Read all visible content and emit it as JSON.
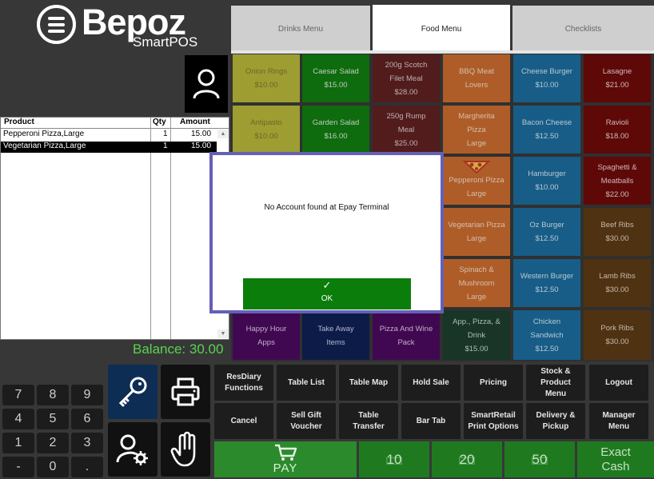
{
  "brand": {
    "name": "Bepoz",
    "sub": "SmartPOS"
  },
  "tabs": [
    {
      "label": "Drinks Menu",
      "active": false
    },
    {
      "label": "Food Menu",
      "active": true
    },
    {
      "label": "Checklists",
      "active": false
    }
  ],
  "order": {
    "headers": {
      "product": "Product",
      "qty": "Qty",
      "amount": "Amount"
    },
    "rows": [
      {
        "product": "Pepperoni Pizza,Large",
        "qty": "1",
        "amount": "15.00",
        "selected": false
      },
      {
        "product": "Vegetarian Pizza,Large",
        "qty": "1",
        "amount": "15.00",
        "selected": true
      }
    ],
    "balance": "Balance: 30.00"
  },
  "menu": {
    "onion_rings": [
      "Onion Rings",
      "$10.00"
    ],
    "caesar_salad": [
      "Caesar Salad",
      "$15.00"
    ],
    "scotch_fillet": [
      "200g Scotch",
      "Filet Meal",
      "$28.00"
    ],
    "bbq_meat": [
      "BBQ Meat",
      "Lovers"
    ],
    "cheese_burger": [
      "Cheese Burger",
      "$10.00"
    ],
    "lasagne": [
      "Lasagne",
      "$21.00"
    ],
    "antipasto": [
      "Antipasto",
      "$10.00"
    ],
    "garden_salad": [
      "Garden Salad",
      "$16.00"
    ],
    "rump_meal": [
      "250g Rump",
      "Meal",
      "$25.00"
    ],
    "margherita": [
      "Margherita",
      "Pizza",
      "Large"
    ],
    "bacon_cheese": [
      "Bacon Cheese",
      "$12.50"
    ],
    "ravioli": [
      "Ravioli",
      "$18.00"
    ],
    "pepperoni": [
      "Pepperoni Pizza",
      "Large"
    ],
    "hamburger": [
      "Hamburger",
      "$10.00"
    ],
    "spaghetti": [
      "Spaghetti &",
      "Meatballs",
      "$22.00"
    ],
    "vegetarian": [
      "Vegetarian Pizza",
      "Large"
    ],
    "oz_burger": [
      "Oz Burger",
      "$12.50"
    ],
    "beef_ribs": [
      "Beef Ribs",
      "$30.00"
    ],
    "spinach": [
      "Spinach &",
      "Mushroom",
      "Large"
    ],
    "western_burger": [
      "Western Burger",
      "$12.50"
    ],
    "lamb_ribs": [
      "Lamb Ribs",
      "$30.00"
    ],
    "happy_hour": [
      "Happy Hour",
      "Apps"
    ],
    "take_away": [
      "Take Away",
      "Items"
    ],
    "pizza_wine": [
      "Pizza And Wine",
      "Pack"
    ],
    "app_pizza": [
      "App., Pizza, &",
      "Drink",
      "$15.00"
    ],
    "chicken_sandwich": [
      "Chicken",
      "Sandwich",
      "$12.50"
    ],
    "pork_ribs": [
      "Pork Ribs",
      "$30.00"
    ]
  },
  "dialog": {
    "message": "No Account found at Epay Terminal",
    "ok_label": "OK",
    "check": "✓"
  },
  "keypad": {
    "k7": "7",
    "k8": "8",
    "k9": "9",
    "k4": "4",
    "k5": "5",
    "k6": "6",
    "k1": "1",
    "k2": "2",
    "k3": "3",
    "kminus": "-",
    "k0": "0",
    "kdot": "."
  },
  "functions": {
    "resdiary": [
      "ResDiary",
      "Functions"
    ],
    "table_list": [
      "Table List"
    ],
    "table_map": [
      "Table Map"
    ],
    "hold_sale": [
      "Hold Sale"
    ],
    "pricing": [
      "Pricing"
    ],
    "stock_menu": [
      "Stock &",
      "Product",
      "Menu"
    ],
    "logout": [
      "Logout"
    ],
    "cancel": [
      "Cancel"
    ],
    "sell_gift": [
      "Sell Gift",
      "Voucher"
    ],
    "table_transfer": [
      "Table",
      "Transfer"
    ],
    "bar_tab": [
      "Bar Tab"
    ],
    "smartretail": [
      "SmartRetail",
      "Print Options"
    ],
    "delivery": [
      "Delivery &",
      "Pickup"
    ],
    "manager": [
      "Manager",
      "Menu"
    ]
  },
  "pay": {
    "pay": "PAY",
    "ten": "10",
    "twenty": "20",
    "fifty": "50",
    "exact1": "Exact",
    "exact2": "Cash"
  },
  "icons": [
    "hamburger-logo-icon",
    "user-icon",
    "key-icon",
    "printer-icon",
    "user-gear-icon",
    "hand-icon",
    "cart-icon",
    "cash-icon"
  ]
}
